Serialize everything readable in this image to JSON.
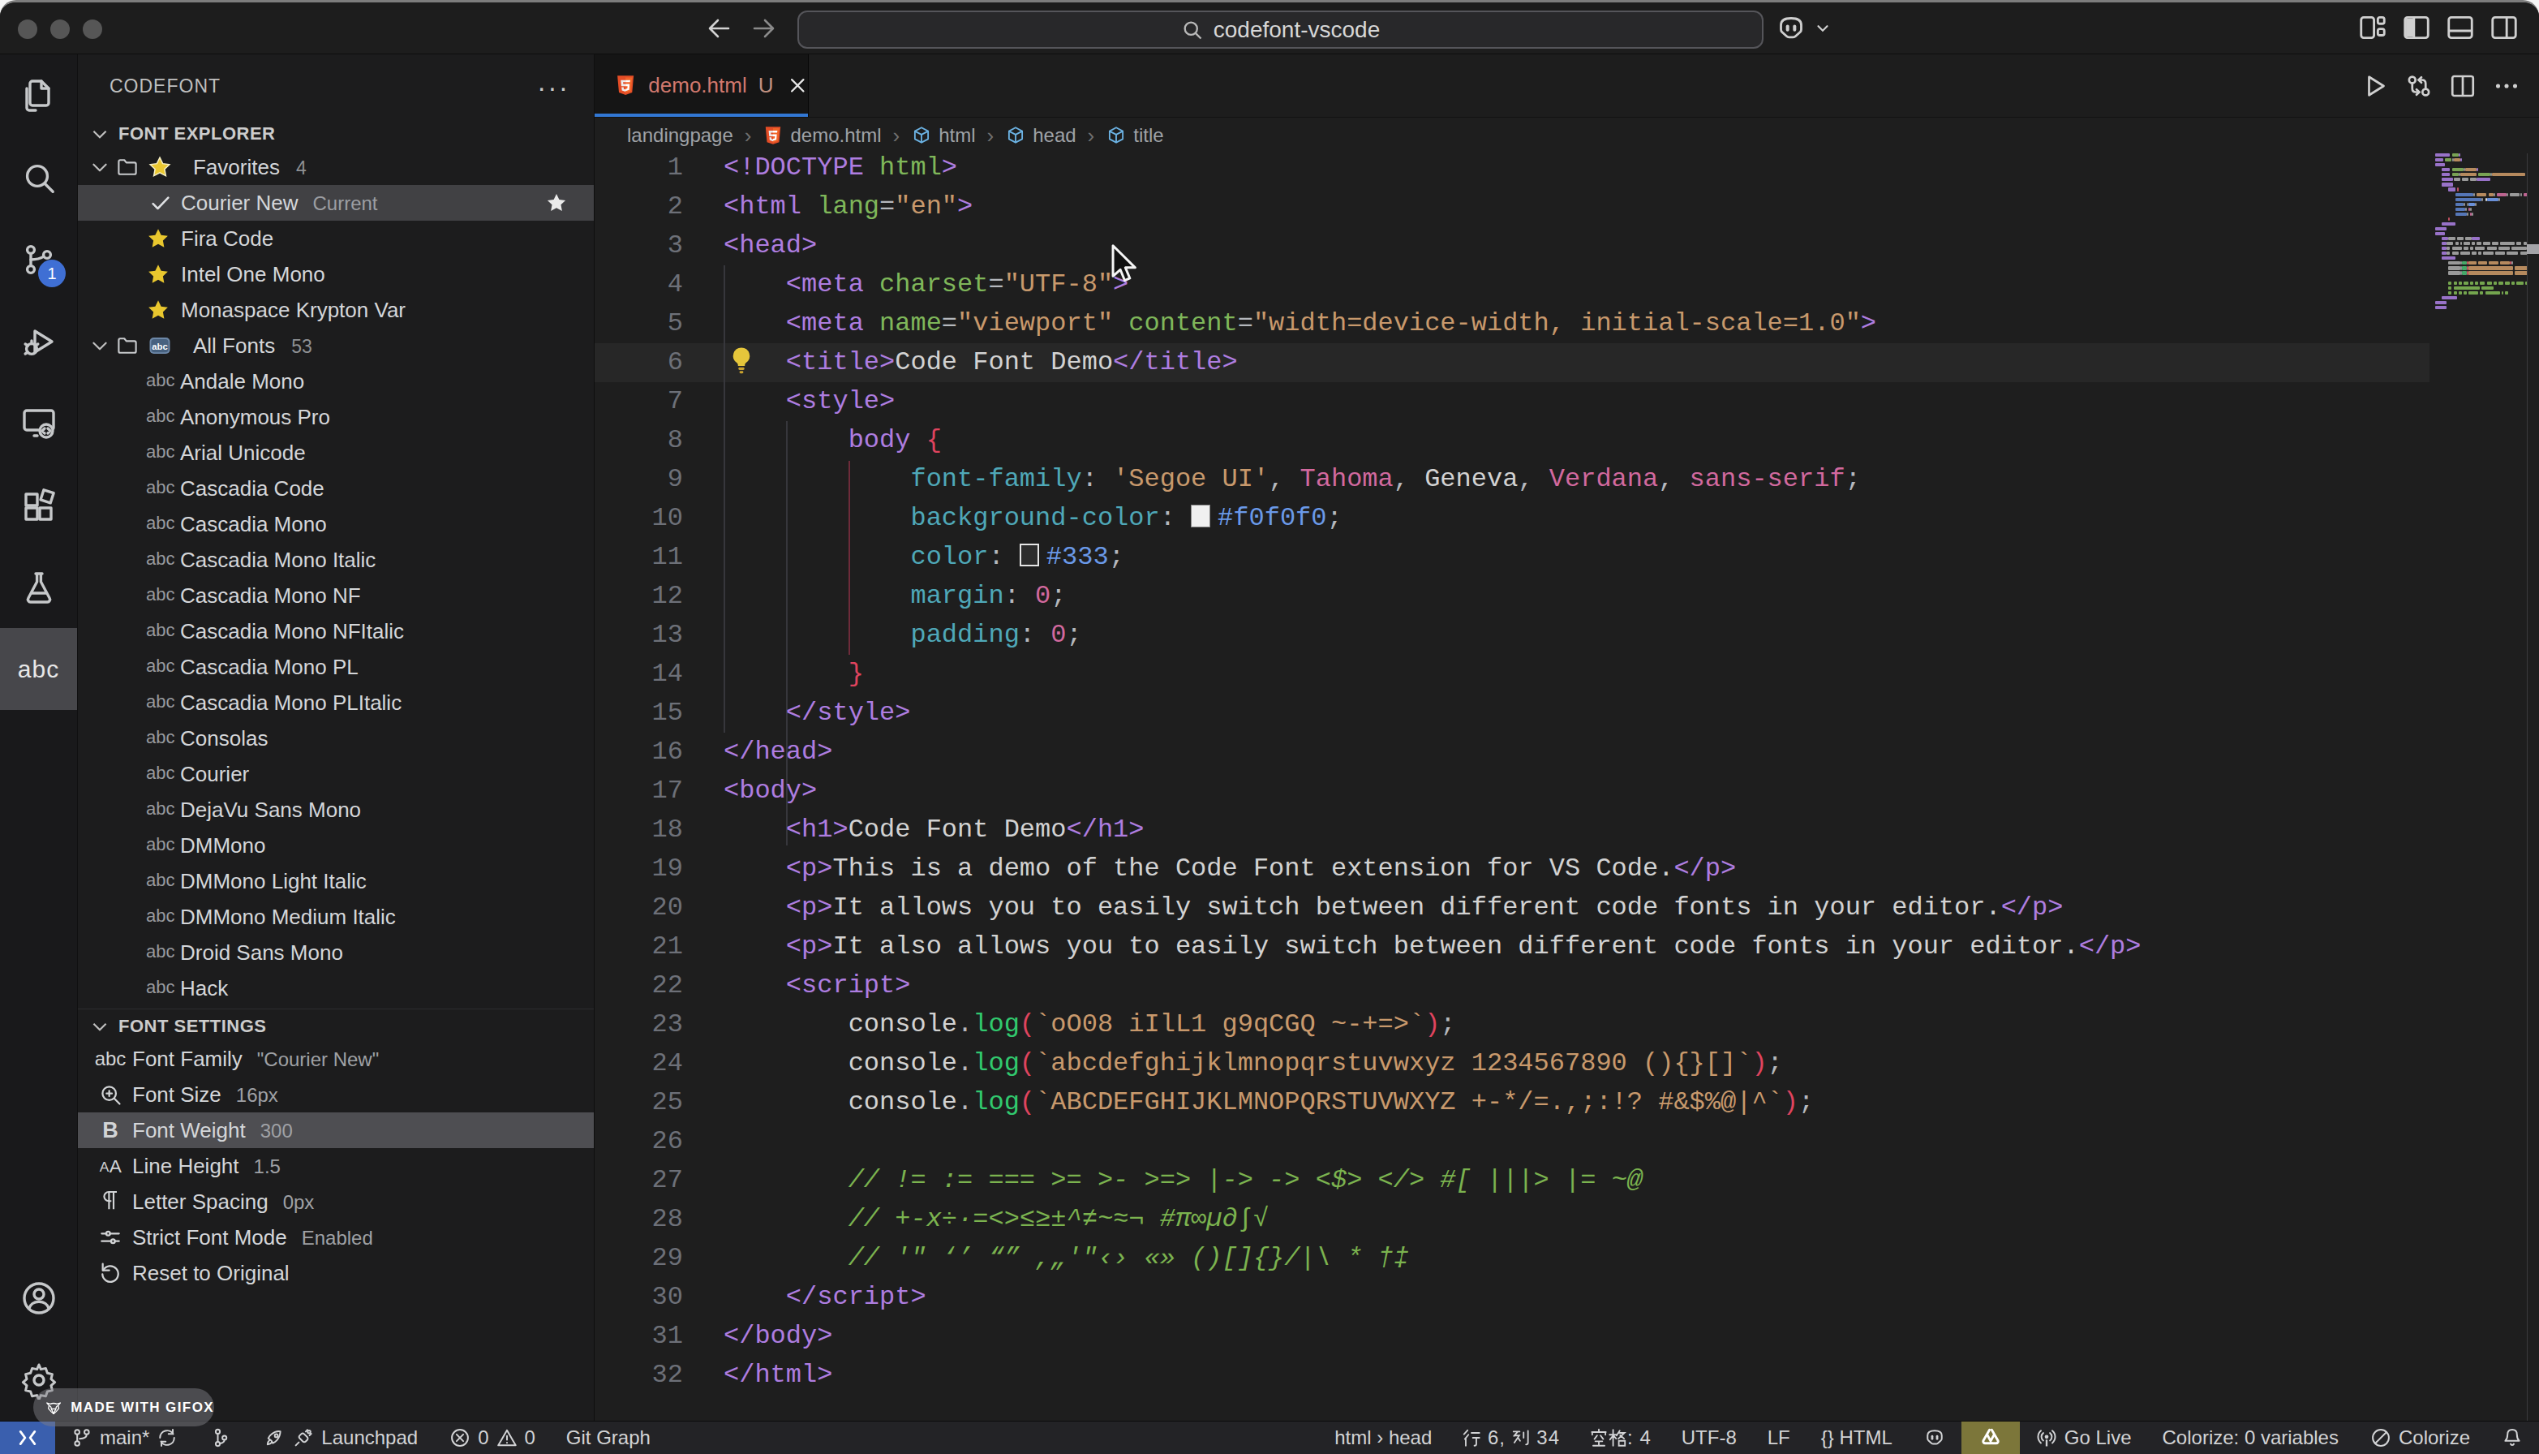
{
  "titlebar": {
    "search_value": "codefont-vscode",
    "traffic_lights": [
      "close",
      "minimize",
      "zoom"
    ],
    "right_icons": [
      "customize-layout-icon",
      "toggle-sidebar-icon",
      "toggle-panel-icon",
      "toggle-secondary-sidebar-icon"
    ]
  },
  "activity_bar": {
    "items": [
      {
        "name": "explorer-icon"
      },
      {
        "name": "search-icon"
      },
      {
        "name": "source-control-icon",
        "badge": "1"
      },
      {
        "name": "run-debug-icon"
      },
      {
        "name": "remote-explorer-icon"
      },
      {
        "name": "extensions-icon"
      },
      {
        "name": "testing-icon"
      },
      {
        "name": "codefont-abc-icon",
        "label": "abc",
        "active": true
      }
    ],
    "bottom_items": [
      {
        "name": "account-icon"
      },
      {
        "name": "settings-gear-icon"
      }
    ]
  },
  "sidebar": {
    "title": "CODEFONT",
    "more_label": "···",
    "explorer_section": "FONT EXPLORER",
    "settings_section": "FONT SETTINGS",
    "tree": [
      {
        "type": "folder",
        "deco": "star-emoji",
        "label": "Favorites",
        "count": "4"
      },
      {
        "type": "current",
        "label": "Courier New",
        "badge": "Current",
        "selected": true,
        "starred": true
      },
      {
        "type": "fav",
        "label": "Fira Code"
      },
      {
        "type": "fav",
        "label": "Intel One Mono"
      },
      {
        "type": "fav",
        "label": "Monaspace Krypton Var"
      },
      {
        "type": "folder",
        "deco": "abc-badge",
        "label": "All Fonts",
        "count": "53"
      },
      {
        "type": "font",
        "label": "Andale Mono"
      },
      {
        "type": "font",
        "label": "Anonymous Pro"
      },
      {
        "type": "font",
        "label": "Arial Unicode"
      },
      {
        "type": "font",
        "label": "Cascadia Code"
      },
      {
        "type": "font",
        "label": "Cascadia Mono"
      },
      {
        "type": "font",
        "label": "Cascadia Mono Italic"
      },
      {
        "type": "font",
        "label": "Cascadia Mono NF"
      },
      {
        "type": "font",
        "label": "Cascadia Mono NFItalic"
      },
      {
        "type": "font",
        "label": "Cascadia Mono PL"
      },
      {
        "type": "font",
        "label": "Cascadia Mono PLItalic"
      },
      {
        "type": "font",
        "label": "Consolas"
      },
      {
        "type": "font",
        "label": "Courier"
      },
      {
        "type": "font",
        "label": "DejaVu Sans Mono"
      },
      {
        "type": "font",
        "label": "DMMono"
      },
      {
        "type": "font",
        "label": "DMMono Light Italic"
      },
      {
        "type": "font",
        "label": "DMMono Medium Italic"
      },
      {
        "type": "font",
        "label": "Droid Sans Mono"
      },
      {
        "type": "font",
        "label": "Hack"
      }
    ],
    "settings": [
      {
        "icon": "abc-text-icon",
        "label": "Font Family",
        "value": "\"Courier New\""
      },
      {
        "icon": "zoom-in-icon",
        "label": "Font Size",
        "value": "16px"
      },
      {
        "icon": "bold-icon",
        "label": "Font Weight",
        "value": "300",
        "selected": true
      },
      {
        "icon": "line-height-icon",
        "label": "Line Height",
        "value": "1.5"
      },
      {
        "icon": "pilcrow-icon",
        "label": "Letter Spacing",
        "value": "0px"
      },
      {
        "icon": "sliders-icon",
        "label": "Strict Font Mode",
        "value": "Enabled"
      },
      {
        "icon": "reset-icon",
        "label": "Reset to Original",
        "value": ""
      }
    ]
  },
  "editor": {
    "tab": {
      "label": "demo.html",
      "git_status": "U",
      "icon": "html5-icon"
    },
    "actions": [
      "run-icon",
      "open-changes-icon",
      "split-editor-icon",
      "ellipsis-icon"
    ],
    "breadcrumbs": [
      {
        "label": "landingpage"
      },
      {
        "label": "demo.html",
        "icon": "html5-icon"
      },
      {
        "label": "html",
        "icon": "symbol-cube-icon"
      },
      {
        "label": "head",
        "icon": "symbol-cube-icon"
      },
      {
        "label": "title",
        "icon": "symbol-cube-icon"
      }
    ],
    "current_line": 6,
    "code_lines": [
      {
        "n": 1,
        "t": [
          [
            "<!DOCTYPE ",
            "tag"
          ],
          [
            "html",
            "attr"
          ],
          [
            ">",
            "tag"
          ]
        ]
      },
      {
        "n": 2,
        "t": [
          [
            "<html ",
            "tag"
          ],
          [
            "lang",
            "attr"
          ],
          [
            "=",
            "pun"
          ],
          [
            "\"en\"",
            "str"
          ],
          [
            ">",
            "tag"
          ]
        ]
      },
      {
        "n": 3,
        "t": [
          [
            "<head>",
            "tag"
          ]
        ]
      },
      {
        "n": 4,
        "t": [
          [
            "    ",
            "pln"
          ],
          [
            "<meta ",
            "tag"
          ],
          [
            "charset",
            "attr"
          ],
          [
            "=",
            "pun"
          ],
          [
            "\"UTF-8\"",
            "str"
          ],
          [
            ">",
            "tag"
          ]
        ]
      },
      {
        "n": 5,
        "t": [
          [
            "    ",
            "pln"
          ],
          [
            "<meta ",
            "tag"
          ],
          [
            "name",
            "attr"
          ],
          [
            "=",
            "pun"
          ],
          [
            "\"viewport\"",
            "str"
          ],
          [
            " ",
            "pln"
          ],
          [
            "content",
            "attr"
          ],
          [
            "=",
            "pun"
          ],
          [
            "\"width=device-width, initial-scale=1.0\"",
            "str"
          ],
          [
            ">",
            "tag"
          ]
        ]
      },
      {
        "n": 6,
        "t": [
          [
            "    ",
            "pln"
          ],
          [
            "<title>",
            "tag"
          ],
          [
            "Code Font Demo",
            "txt"
          ],
          [
            "</title>",
            "tag"
          ]
        ]
      },
      {
        "n": 7,
        "t": [
          [
            "    ",
            "pln"
          ],
          [
            "<style>",
            "tag"
          ]
        ]
      },
      {
        "n": 8,
        "t": [
          [
            "        ",
            "pln"
          ],
          [
            "body ",
            "tag"
          ],
          [
            "{",
            "red"
          ]
        ]
      },
      {
        "n": 9,
        "t": [
          [
            "            ",
            "pln"
          ],
          [
            "font-family",
            "prop"
          ],
          [
            ": ",
            "pun"
          ],
          [
            "'Segoe UI'",
            "str"
          ],
          [
            ", ",
            "pun"
          ],
          [
            "Tahoma",
            "pink"
          ],
          [
            ", ",
            "pun"
          ],
          [
            "Geneva",
            "txt"
          ],
          [
            ", ",
            "pun"
          ],
          [
            "Verdana",
            "pink"
          ],
          [
            ", ",
            "pun"
          ],
          [
            "sans-serif",
            "pink"
          ],
          [
            ";",
            "pun"
          ]
        ]
      },
      {
        "n": 10,
        "t": [
          [
            "            ",
            "pln"
          ],
          [
            "background-color",
            "prop"
          ],
          [
            ": ",
            "pun"
          ],
          [
            "",
            "swl"
          ],
          [
            "#f0f0f0",
            "val"
          ],
          [
            ";",
            "pun"
          ]
        ]
      },
      {
        "n": 11,
        "t": [
          [
            "            ",
            "pln"
          ],
          [
            "color",
            "prop"
          ],
          [
            ": ",
            "pun"
          ],
          [
            "",
            "swd"
          ],
          [
            "#333",
            "val"
          ],
          [
            ";",
            "pun"
          ]
        ]
      },
      {
        "n": 12,
        "t": [
          [
            "            ",
            "pln"
          ],
          [
            "margin",
            "prop"
          ],
          [
            ": ",
            "pun"
          ],
          [
            "0",
            "pink"
          ],
          [
            ";",
            "pun"
          ]
        ]
      },
      {
        "n": 13,
        "t": [
          [
            "            ",
            "pln"
          ],
          [
            "padding",
            "prop"
          ],
          [
            ": ",
            "pun"
          ],
          [
            "0",
            "pink"
          ],
          [
            ";",
            "pun"
          ]
        ]
      },
      {
        "n": 14,
        "t": [
          [
            "        ",
            "pln"
          ],
          [
            "}",
            "red"
          ]
        ]
      },
      {
        "n": 15,
        "t": [
          [
            "    ",
            "pln"
          ],
          [
            "</style>",
            "tag"
          ]
        ]
      },
      {
        "n": 16,
        "t": [
          [
            "</head>",
            "tag"
          ]
        ]
      },
      {
        "n": 17,
        "t": [
          [
            "<body>",
            "tag"
          ]
        ]
      },
      {
        "n": 18,
        "t": [
          [
            "    ",
            "pln"
          ],
          [
            "<h1>",
            "tag"
          ],
          [
            "Code Font Demo",
            "txt"
          ],
          [
            "</h1>",
            "tag"
          ]
        ]
      },
      {
        "n": 19,
        "t": [
          [
            "    ",
            "pln"
          ],
          [
            "<p>",
            "tag"
          ],
          [
            "This is a demo of the Code Font extension for VS Code.",
            "txt"
          ],
          [
            "</p>",
            "tag"
          ]
        ]
      },
      {
        "n": 20,
        "t": [
          [
            "    ",
            "pln"
          ],
          [
            "<p>",
            "tag"
          ],
          [
            "It allows you to easily switch between different code fonts in your editor.",
            "txt"
          ],
          [
            "</p>",
            "tag"
          ]
        ]
      },
      {
        "n": 21,
        "t": [
          [
            "    ",
            "pln"
          ],
          [
            "<p>",
            "tag"
          ],
          [
            "It also allows you to easily switch between different code fonts in your editor.",
            "txt"
          ],
          [
            "</p>",
            "tag"
          ]
        ]
      },
      {
        "n": 22,
        "t": [
          [
            "    ",
            "pln"
          ],
          [
            "<script>",
            "tag"
          ]
        ]
      },
      {
        "n": 23,
        "t": [
          [
            "        ",
            "pln"
          ],
          [
            "console",
            "txt"
          ],
          [
            ".",
            "pun"
          ],
          [
            "log",
            "fn"
          ],
          [
            "(",
            "red"
          ],
          [
            "`oO08 iIlL1 g9qCGQ ~-+=>`",
            "str"
          ],
          [
            ")",
            "red"
          ],
          [
            ";",
            "pun"
          ]
        ]
      },
      {
        "n": 24,
        "t": [
          [
            "        ",
            "pln"
          ],
          [
            "console",
            "txt"
          ],
          [
            ".",
            "pun"
          ],
          [
            "log",
            "fn"
          ],
          [
            "(",
            "red"
          ],
          [
            "`abcdefghijklmnopqrstuvwxyz 1234567890 (){}[]`",
            "str"
          ],
          [
            ")",
            "red"
          ],
          [
            ";",
            "pun"
          ]
        ]
      },
      {
        "n": 25,
        "t": [
          [
            "        ",
            "pln"
          ],
          [
            "console",
            "txt"
          ],
          [
            ".",
            "pun"
          ],
          [
            "log",
            "fn"
          ],
          [
            "(",
            "red"
          ],
          [
            "`ABCDEFGHIJKLMNOPQRSTUVWXYZ +-*/=.,;:!? #&$%@|^`",
            "str"
          ],
          [
            ")",
            "red"
          ],
          [
            ";",
            "pun"
          ]
        ]
      },
      {
        "n": 26,
        "t": []
      },
      {
        "n": 27,
        "t": [
          [
            "        ",
            "pln"
          ],
          [
            "// != := === >= >- >=> |-> -> <$> </> #[ |||> |= ~@",
            "com"
          ]
        ]
      },
      {
        "n": 28,
        "t": [
          [
            "        ",
            "pln"
          ],
          [
            "// +-x÷·=<>≤≥±^≠~≈¬ #π∞µ∂∫√",
            "com"
          ]
        ]
      },
      {
        "n": 29,
        "t": [
          [
            "        ",
            "pln"
          ],
          [
            "// '\" ‘’ “” ,„'\"‹› «» ()[]{}/|\\ * †‡",
            "com"
          ]
        ]
      },
      {
        "n": 30,
        "t": [
          [
            "    ",
            "pln"
          ],
          [
            "</script>",
            "tag"
          ]
        ]
      },
      {
        "n": 31,
        "t": [
          [
            "</body>",
            "tag"
          ]
        ]
      },
      {
        "n": 32,
        "t": [
          [
            "</html>",
            "tag"
          ]
        ]
      }
    ]
  },
  "status_bar": {
    "left": [
      {
        "name": "remote-indicator",
        "chip": "blue",
        "segs": [
          {
            "ic": "remote-icon"
          }
        ]
      },
      {
        "name": "git-branch",
        "segs": [
          {
            "ic": "branch-icon"
          },
          {
            "tx": "main*"
          },
          {
            "ic": "sync-icon"
          }
        ]
      },
      {
        "name": "git-graph-button",
        "segs": [
          {
            "ic": "commit-graph-icon"
          }
        ]
      },
      {
        "name": "launchpad",
        "segs": [
          {
            "ic": "rocket-icon"
          },
          {
            "ic": "plug-icon"
          },
          {
            "tx": "Launchpad"
          }
        ]
      },
      {
        "name": "problems",
        "segs": [
          {
            "ic": "error-icon"
          },
          {
            "tx": "0"
          },
          {
            "ic": "warning-icon"
          },
          {
            "tx": "0"
          }
        ]
      },
      {
        "name": "git-graph-label",
        "segs": [
          {
            "tx": "Git Graph"
          }
        ]
      }
    ],
    "right": [
      {
        "name": "breadcrumb-position",
        "segs": [
          {
            "tx": "html › head"
          }
        ]
      },
      {
        "name": "cursor-position",
        "cjk": true,
        "segs": [
          {
            "tx": "行 6, 列 34"
          }
        ]
      },
      {
        "name": "indentation",
        "cjk": true,
        "segs": [
          {
            "tx": "空格: 4"
          }
        ]
      },
      {
        "name": "encoding",
        "segs": [
          {
            "tx": "UTF-8"
          }
        ]
      },
      {
        "name": "eol",
        "segs": [
          {
            "tx": "LF"
          }
        ]
      },
      {
        "name": "language-mode",
        "segs": [
          {
            "tx": "{} HTML"
          }
        ]
      },
      {
        "name": "copilot-status",
        "segs": [
          {
            "ic": "copilot-icon"
          }
        ]
      },
      {
        "name": "extension-chip",
        "chip": "gold",
        "segs": [
          {
            "ic": "knot-icon"
          }
        ]
      },
      {
        "name": "go-live",
        "segs": [
          {
            "ic": "broadcast-icon"
          },
          {
            "tx": "Go Live"
          }
        ]
      },
      {
        "name": "colorize-variables",
        "segs": [
          {
            "tx": "Colorize: 0 variables"
          }
        ]
      },
      {
        "name": "colorize-toggle",
        "segs": [
          {
            "ic": "slash-circle-icon"
          },
          {
            "tx": "Colorize"
          }
        ]
      },
      {
        "name": "notifications",
        "segs": [
          {
            "ic": "bell-icon"
          }
        ]
      }
    ]
  },
  "overlay": {
    "badge_text": "MADE WITH GIFOX"
  },
  "colors": {
    "accent_blue": "#3277d3",
    "remote_chip": "#3a5fae",
    "gold_chip": "#7c763a",
    "tab_label": "#d1786d",
    "selection_grey": "#414144"
  }
}
